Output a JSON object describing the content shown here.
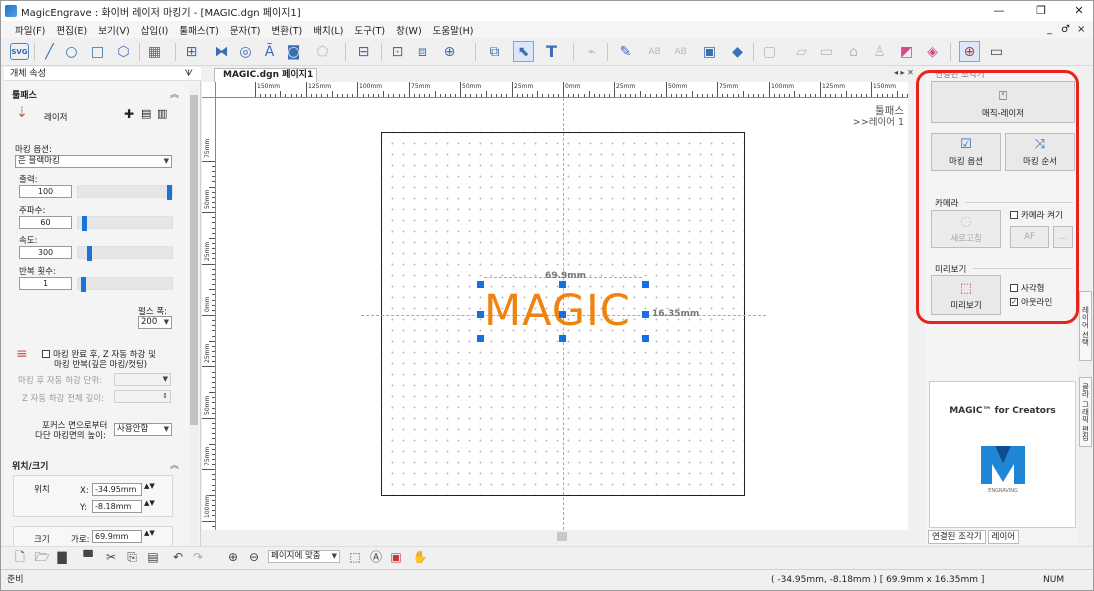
{
  "window": {
    "title": "MagicEngrave : 화이버 레이저 마킹기 - [MAGIC.dgn  페이지1]",
    "min_glyph": "—",
    "restore_glyph": "❐",
    "close_glyph": "✕"
  },
  "menu": {
    "items": [
      "파일(F)",
      "편집(E)",
      "보기(V)",
      "삽입(I)",
      "툴패스(T)",
      "문자(T)",
      "변환(T)",
      "배치(L)",
      "도구(T)",
      "창(W)",
      "도움말(H)"
    ],
    "mdi_controls": [
      "_",
      "♂",
      "×"
    ]
  },
  "toolbar": {
    "svg_label": "SVG",
    "abc_label": "AB",
    "abc2_label": "AB",
    "text_tool_label": "T"
  },
  "left_panel": {
    "header": "개체 속성",
    "pin": "ᗐ",
    "toolpath_section": "툴패스",
    "laser_label": "레이저",
    "marking_option_label": "마킹 옵션:",
    "marking_option_value": "은 블랙마킹",
    "power_label": "출력:",
    "power_value": "100",
    "power_level": 1.0,
    "frequency_label": "주파수:",
    "frequency_value": "60",
    "frequency_level": 0.05,
    "speed_label": "속도:",
    "speed_value": "300",
    "speed_level": 0.1,
    "repeat_label": "반복 횟수:",
    "repeat_value": "1",
    "repeat_level": 0.03,
    "pulse_label": "펄스 폭:",
    "pulse_value": "200",
    "zdown_line1": "마킹 완료 후, Z 자동 하강 및",
    "zdown_line2": "마킹 반복(깊은 마킹/컷팅)",
    "auto_down_unit_label": "마킹 후 자동 하강 단위:",
    "z_total_label": "Z 자동 하강 전체 깊이:",
    "focus_line1": "포커스 면으로부터",
    "focus_line2": "다단 마킹면의 높이:",
    "focus_value": "사용안함",
    "position_section": "위치/크기",
    "position_label": "위치",
    "x_label": "X:",
    "x_value": "-34.95mm",
    "y_label": "Y:",
    "y_value": "-8.18mm",
    "size_label": "크기",
    "width_label": "가로:",
    "width_value": "69.9mm"
  },
  "document": {
    "tab": "MAGIC.dgn  페이지1",
    "toolpath_title": "툴패스",
    "layer_label": ">>레이어 1",
    "text": "MAGIC",
    "width_dim": "69.9mm",
    "height_dim": "16.35mm",
    "h_ruler_labels": [
      "150mm",
      "125mm",
      "100mm",
      "75mm",
      "50mm",
      "25mm",
      "0mm",
      "25mm",
      "50mm",
      "75mm",
      "100mm",
      "125mm",
      "150mm"
    ],
    "v_ruler_labels": [
      "75mm",
      "50mm",
      "25mm",
      "0mm",
      "25mm",
      "50mm",
      "75mm",
      "100mm"
    ]
  },
  "right_panel": {
    "header": "연결된 조각기",
    "machine_button": "매직-레이저",
    "marking_option_button": "마킹 옵션",
    "marking_order_button": "마킹 순서",
    "camera_title": "카메라",
    "camera_on": "카메라 켜기",
    "refresh_button": "새로고침",
    "af_button": "AF",
    "more_button": "...",
    "preview_title": "미리보기",
    "preview_button": "미리보기",
    "rect_check": "사각형",
    "outline_check": "아웃라인",
    "brand_title": "MAGIC™ for Creators",
    "brand_sub": "ENGRAVING",
    "tabs": [
      "연결된 조각기",
      "레이어"
    ],
    "side_tabs": [
      "레이어 선택",
      "클라 그래픽 편집"
    ]
  },
  "bottom_toolbar": {
    "zoom_fit": "페이지에 맞춤"
  },
  "status": {
    "ready": "준비",
    "coords": "( -34.95mm, -8.18mm ) [ 69.9mm x 16.35mm ]",
    "num": "NUM"
  }
}
